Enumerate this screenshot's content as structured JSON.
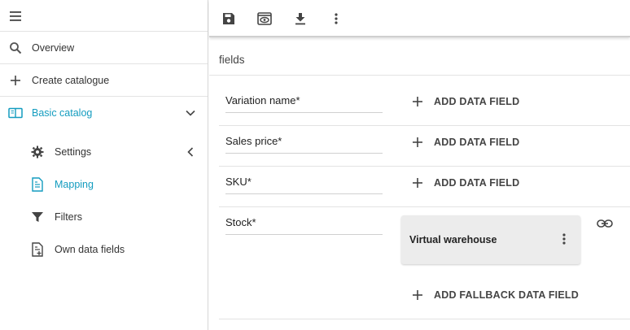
{
  "sidebar": {
    "items": [
      {
        "label": "Overview",
        "icon": "search-icon"
      },
      {
        "label": "Create catalogue",
        "icon": "plus-icon"
      },
      {
        "label": "Basic catalog",
        "icon": "book-icon"
      },
      {
        "label": "Settings",
        "icon": "gear-icon"
      },
      {
        "label": "Mapping",
        "icon": "document-icon"
      },
      {
        "label": "Filters",
        "icon": "funnel-icon"
      },
      {
        "label": "Own data fields",
        "icon": "document-add-icon"
      }
    ]
  },
  "toolbar": {
    "icons": [
      "save-icon",
      "preview-icon",
      "download-icon",
      "more-vert-icon"
    ]
  },
  "main": {
    "section_title": "fields",
    "rows": [
      {
        "label": "Variation name*",
        "action": "ADD DATA FIELD"
      },
      {
        "label": "Sales price*",
        "action": "ADD DATA FIELD"
      },
      {
        "label": "SKU*",
        "action": "ADD DATA FIELD"
      },
      {
        "label": "Stock*",
        "card_title": "Virtual warehouse",
        "action": "ADD FALLBACK DATA FIELD"
      }
    ]
  },
  "colors": {
    "accent": "#139cbf",
    "text": "#222222",
    "card_bg": "#ececec"
  }
}
